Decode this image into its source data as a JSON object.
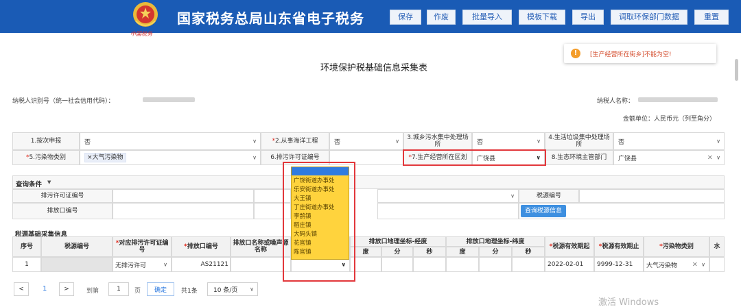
{
  "header": {
    "emblem_caption": "中国税务",
    "title": "国家税务总局山东省电子税务",
    "buttons": [
      "保存",
      "作废",
      "批量导入",
      "模板下载",
      "导出",
      "调取环保部门数据",
      "重置"
    ]
  },
  "toast": {
    "message": "[生产经营所在街乡]不能为空!"
  },
  "page_title": "环境保护税基础信息采集表",
  "taxpayer": {
    "id_label": "纳税人识别号（统一社会信用代码）：",
    "name_label": "纳税人名称：",
    "unit_note": "金额单位：人民币元（列至角分）"
  },
  "form": {
    "row1": {
      "f1_label": "1.按次申报",
      "f1_value": "否",
      "f2_label": "2.从事海洋工程",
      "f2_value": "否",
      "f3_label": "3.城乡污水集中处理场所",
      "f3_value": "否",
      "f4_label": "4.生活垃圾集中处理场所",
      "f4_value": "否"
    },
    "row2": {
      "f5_label": "5.污染物类别",
      "f5_tag": "大气污染物",
      "f6_label": "6.排污许可证编号",
      "f7_label": "7.生产经营所在区划",
      "f7_value": "广饶县",
      "f8_label": "8.生态环境主管部门",
      "f8_value": "广饶县"
    },
    "required_mark": "*",
    "tag_remove": "×",
    "clear": "×"
  },
  "query": {
    "title": "查询条件",
    "permit_label": "排污许可证编号",
    "outlet_label": "排放口编号",
    "source_code_label": "税源编号",
    "search_button": "查询税源信息"
  },
  "table": {
    "section_title": "税源基础采集信息",
    "headers": {
      "seq": "序号",
      "source_code": "税源编号",
      "permit_no": "对应排污许可证编号",
      "outlet_no": "排放口编号",
      "outlet_name": "排放口名称或噪声源名称",
      "longitude": "排放口地理坐标-经度",
      "latitude": "排放口地理坐标-纬度",
      "deg": "度",
      "min": "分",
      "sec": "秒",
      "start": "税源有效期起",
      "end": "税源有效期止",
      "pollutant_type": "污染物类别",
      "water": "水"
    },
    "rows": [
      {
        "seq": "1",
        "permit_no": "无排污许可",
        "outlet_no": "AS21121",
        "start": "2022-02-01",
        "end": "9999-12-31",
        "pollutant_type": "大气污染物"
      }
    ]
  },
  "dropdown": {
    "items": [
      "广饶街道办事处",
      "乐安街道办事处",
      "大王镇",
      "丁庄街道办事处",
      "李鹊镇",
      "稻庄镇",
      "大码头镇",
      "花官镇",
      "陈官镇"
    ]
  },
  "pagination": {
    "prev": "<",
    "current": "1",
    "next": ">",
    "goto_label": "到第",
    "page_input": "1",
    "page_unit": "页",
    "confirm": "确定",
    "total": "共1条",
    "page_size": "10 条/页"
  },
  "watermark": "激活 Windows",
  "colors": {
    "header_bg": "#1a5bb5",
    "dropdown_bg": "#ffd33d",
    "highlight_border": "#e2373b",
    "primary": "#3d8fe0"
  }
}
